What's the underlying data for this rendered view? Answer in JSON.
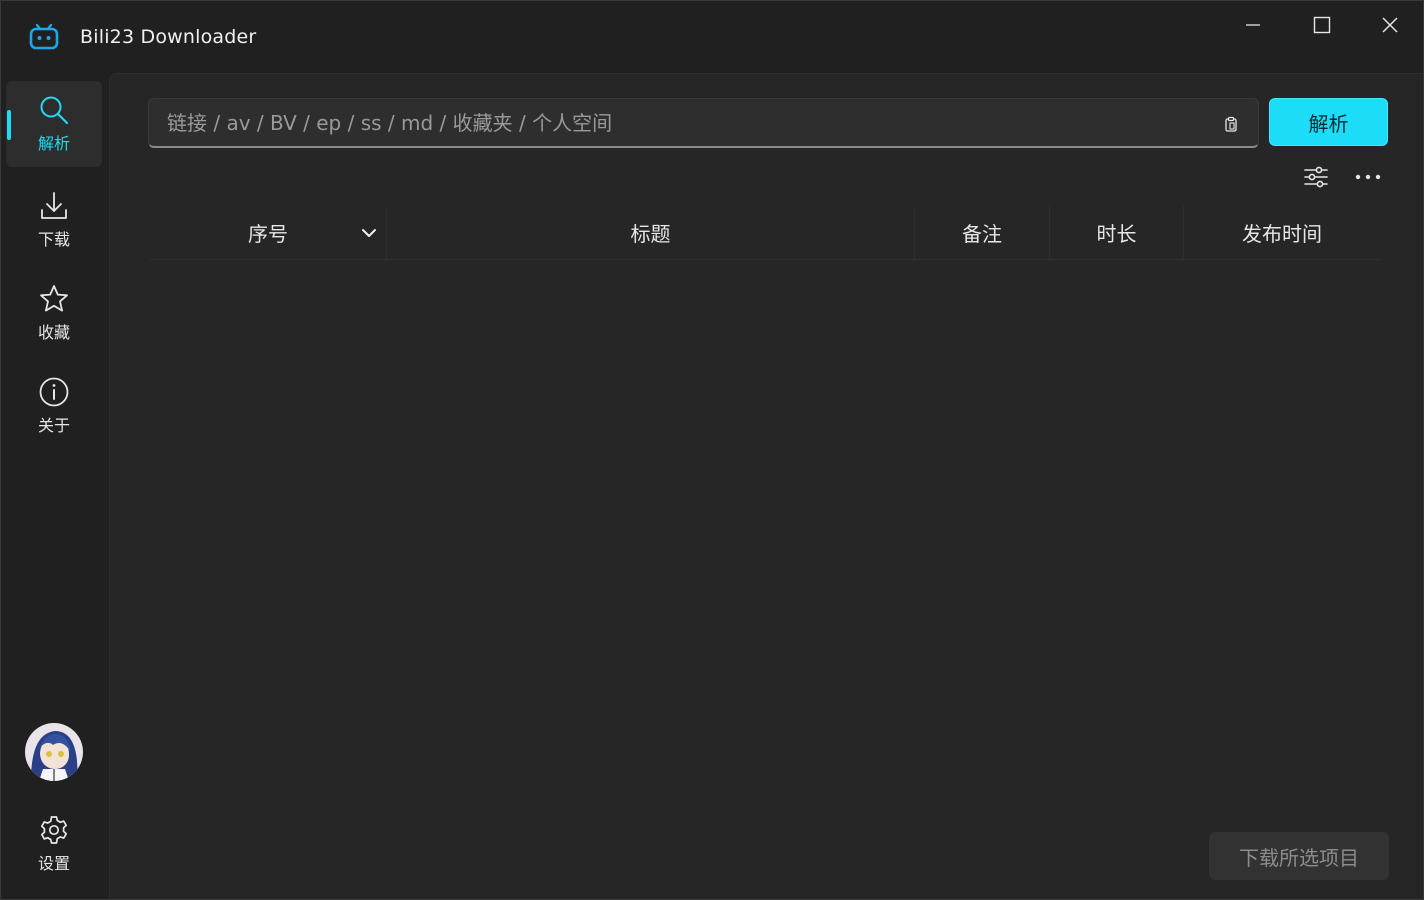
{
  "window": {
    "title": "Bili23 Downloader",
    "icons": {
      "logo": "bilibili-tv-icon",
      "minimize": "minimize-icon",
      "maximize": "maximize-icon",
      "close": "close-icon"
    }
  },
  "sidebar": {
    "items": [
      {
        "id": "parse",
        "label": "解析",
        "icon": "search-icon",
        "active": true
      },
      {
        "id": "download",
        "label": "下载",
        "icon": "download-icon",
        "active": false
      },
      {
        "id": "favorites",
        "label": "收藏",
        "icon": "star-icon",
        "active": false
      },
      {
        "id": "about",
        "label": "关于",
        "icon": "info-icon",
        "active": false
      }
    ],
    "settings": {
      "label": "设置",
      "icon": "gear-icon"
    },
    "avatar": {
      "icon": "user-avatar"
    }
  },
  "search": {
    "placeholder": "链接 / av / BV / ep / ss / md / 收藏夹 / 个人空间",
    "value": "",
    "paste_icon": "clipboard-paste-icon",
    "button_label": "解析"
  },
  "toolbar": {
    "filter_icon": "sliders-icon",
    "more_icon": "more-icon"
  },
  "table": {
    "columns": [
      "序号",
      "标题",
      "备注",
      "时长",
      "发布时间"
    ],
    "rows": []
  },
  "footer": {
    "download_selected_label": "下载所选项目"
  },
  "colors": {
    "accent": "#1ddcf7",
    "background": "#202020",
    "panel": "#262626"
  }
}
